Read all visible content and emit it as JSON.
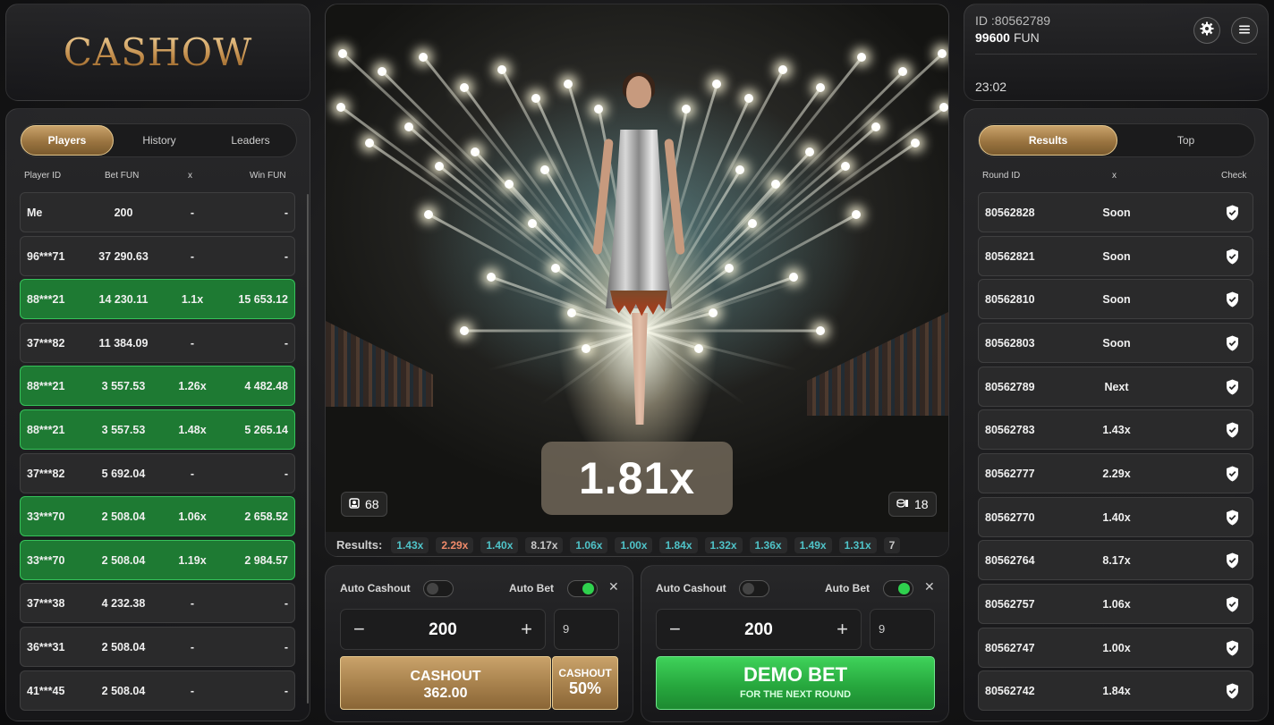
{
  "logo": {
    "text": "CASHOW"
  },
  "players": {
    "tabs": [
      "Players",
      "History",
      "Leaders"
    ],
    "columns": [
      "Player ID",
      "Bet  FUN",
      "x",
      "Win  FUN"
    ],
    "rows": [
      {
        "id": "Me",
        "bet": "200",
        "x": "-",
        "win": "-",
        "won": false
      },
      {
        "id": "96***71",
        "bet": "37 290.63",
        "x": "-",
        "win": "-",
        "won": false
      },
      {
        "id": "88***21",
        "bet": "14 230.11",
        "x": "1.1x",
        "win": "15 653.12",
        "won": true
      },
      {
        "id": "37***82",
        "bet": "11 384.09",
        "x": "-",
        "win": "-",
        "won": false
      },
      {
        "id": "88***21",
        "bet": "3 557.53",
        "x": "1.26x",
        "win": "4 482.48",
        "won": true
      },
      {
        "id": "88***21",
        "bet": "3 557.53",
        "x": "1.48x",
        "win": "5 265.14",
        "won": true
      },
      {
        "id": "37***82",
        "bet": "5 692.04",
        "x": "-",
        "win": "-",
        "won": false
      },
      {
        "id": "33***70",
        "bet": "2 508.04",
        "x": "1.06x",
        "win": "2 658.52",
        "won": true
      },
      {
        "id": "33***70",
        "bet": "2 508.04",
        "x": "1.19x",
        "win": "2 984.57",
        "won": true
      },
      {
        "id": "37***38",
        "bet": "4 232.38",
        "x": "-",
        "win": "-",
        "won": false
      },
      {
        "id": "36***31",
        "bet": "2 508.04",
        "x": "-",
        "win": "-",
        "won": false
      },
      {
        "id": "41***45",
        "bet": "2 508.04",
        "x": "-",
        "win": "-",
        "won": false
      }
    ]
  },
  "game": {
    "multiplier": "1.81x",
    "players_count": "68",
    "bets_count": "18",
    "results_label": "Results:",
    "results": [
      {
        "v": "1.43x",
        "c": "#4fc3c8"
      },
      {
        "v": "2.29x",
        "c": "#f08a6a"
      },
      {
        "v": "1.40x",
        "c": "#4fc3c8"
      },
      {
        "v": "8.17x",
        "c": "#c9c9c9"
      },
      {
        "v": "1.06x",
        "c": "#4fc3c8"
      },
      {
        "v": "1.00x",
        "c": "#4fc3c8"
      },
      {
        "v": "1.84x",
        "c": "#4fc3c8"
      },
      {
        "v": "1.32x",
        "c": "#4fc3c8"
      },
      {
        "v": "1.36x",
        "c": "#4fc3c8"
      },
      {
        "v": "1.49x",
        "c": "#4fc3c8"
      },
      {
        "v": "1.31x",
        "c": "#4fc3c8"
      },
      {
        "v": "7",
        "c": "#c9c9c9"
      }
    ]
  },
  "bet_left": {
    "auto_cashout": "Auto Cashout",
    "auto_bet": "Auto Bet",
    "auto_cashout_on": false,
    "auto_bet_on": true,
    "amount": "200",
    "count": "9",
    "cashout_label": "CASHOUT",
    "cashout_amount": "362.00",
    "cashout_pct_label": "CASHOUT",
    "cashout_pct": "50%"
  },
  "bet_right": {
    "auto_cashout": "Auto Cashout",
    "auto_bet": "Auto Bet",
    "auto_cashout_on": false,
    "auto_bet_on": true,
    "amount": "200",
    "count": "9",
    "demo_label": "DEMO BET",
    "demo_sub": "FOR THE NEXT ROUND"
  },
  "account": {
    "id": "ID :80562789",
    "balance": "99600",
    "currency": "FUN",
    "time": "23:02"
  },
  "results_panel": {
    "tabs": [
      "Results",
      "Top"
    ],
    "columns": [
      "Round ID",
      "x",
      "Check"
    ],
    "rows": [
      {
        "round": "80562828",
        "x": "Soon"
      },
      {
        "round": "80562821",
        "x": "Soon"
      },
      {
        "round": "80562810",
        "x": "Soon"
      },
      {
        "round": "80562803",
        "x": "Soon"
      },
      {
        "round": "80562789",
        "x": "Next"
      },
      {
        "round": "80562783",
        "x": "1.43x"
      },
      {
        "round": "80562777",
        "x": "2.29x"
      },
      {
        "round": "80562770",
        "x": "1.40x"
      },
      {
        "round": "80562764",
        "x": "8.17x"
      },
      {
        "round": "80562757",
        "x": "1.06x"
      },
      {
        "round": "80562747",
        "x": "1.00x"
      },
      {
        "round": "80562742",
        "x": "1.84x"
      }
    ]
  }
}
